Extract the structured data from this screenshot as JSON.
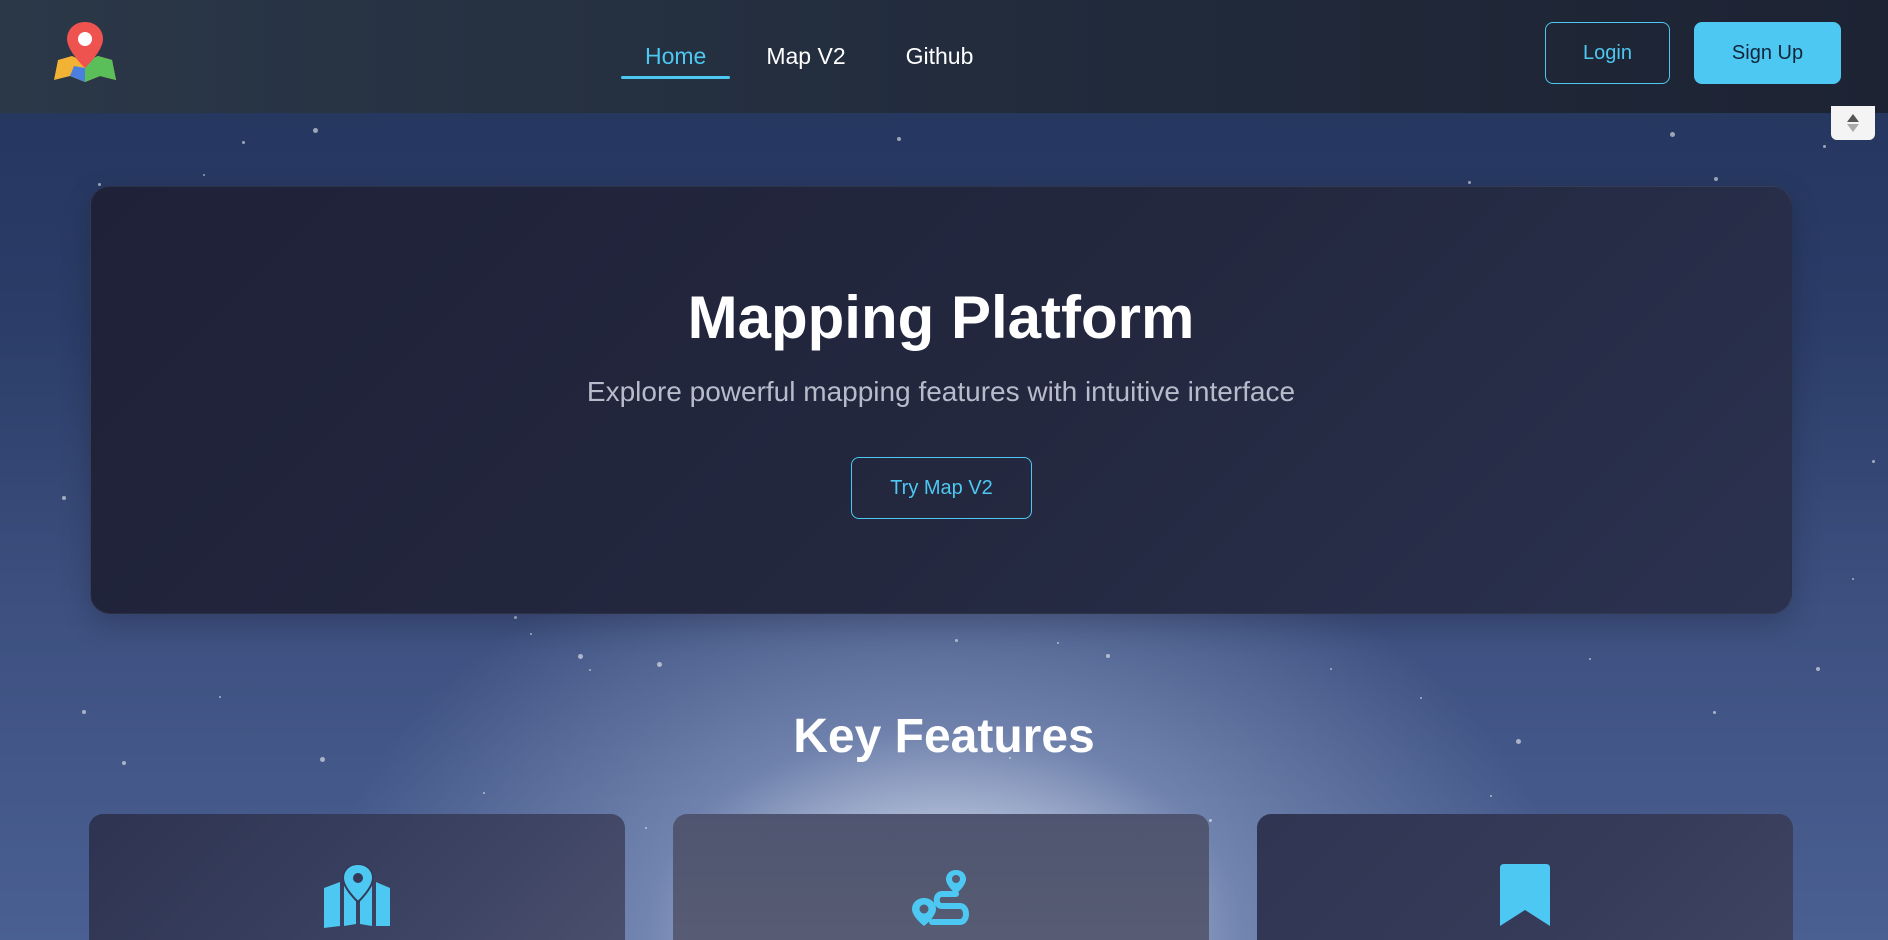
{
  "colors": {
    "accent": "#4dc8f2",
    "navbar_bg": "#222c3d",
    "hero_bg": "#22263d",
    "text": "#ffffff",
    "muted_text": "#b7bccb"
  },
  "navbar": {
    "logo_icon": "map-pin-logo-icon",
    "links": [
      {
        "label": "Home",
        "active": true
      },
      {
        "label": "Map V2",
        "active": false
      },
      {
        "label": "Github",
        "active": false
      }
    ],
    "login_label": "Login",
    "signup_label": "Sign Up"
  },
  "hero": {
    "title": "Mapping Platform",
    "subtitle": "Explore powerful mapping features with intuitive interface",
    "cta_label": "Try Map V2"
  },
  "features": {
    "title": "Key Features",
    "cards": [
      {
        "icon": "map-location-icon"
      },
      {
        "icon": "route-icon"
      },
      {
        "icon": "bookmark-icon"
      }
    ]
  }
}
